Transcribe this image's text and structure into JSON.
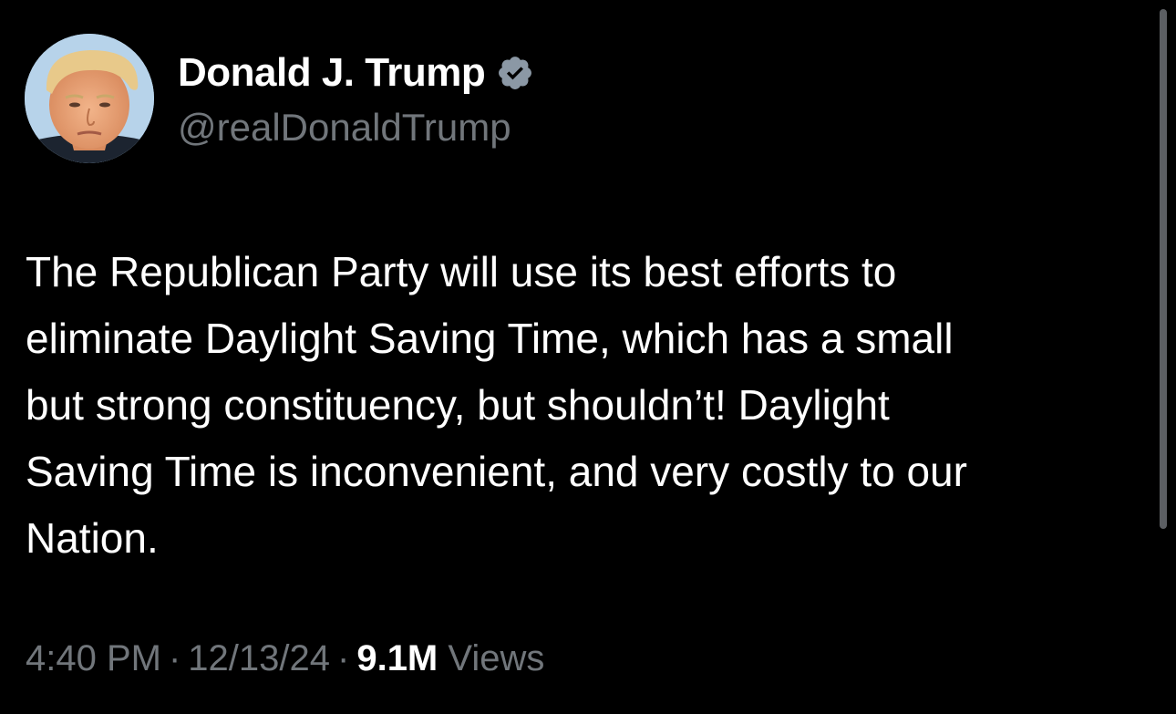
{
  "author": {
    "display_name": "Donald J. Trump",
    "handle": "@realDonaldTrump",
    "verified_icon": "verified-badge-icon",
    "verified_color": "#8b98a5"
  },
  "tweet": {
    "text": "The Republican Party will use its best efforts to\neliminate Daylight Saving Time, which has a small\nbut strong constituency, but shouldn’t! Daylight\nSaving Time is inconvenient, and very costly to our\nNation."
  },
  "meta": {
    "time": "4:40 PM",
    "date": "12/13/24",
    "separator": "·",
    "views_count": "9.1M",
    "views_label": "Views"
  },
  "theme": {
    "background": "#000000",
    "text_primary": "#ffffff",
    "text_secondary": "#71767b"
  }
}
